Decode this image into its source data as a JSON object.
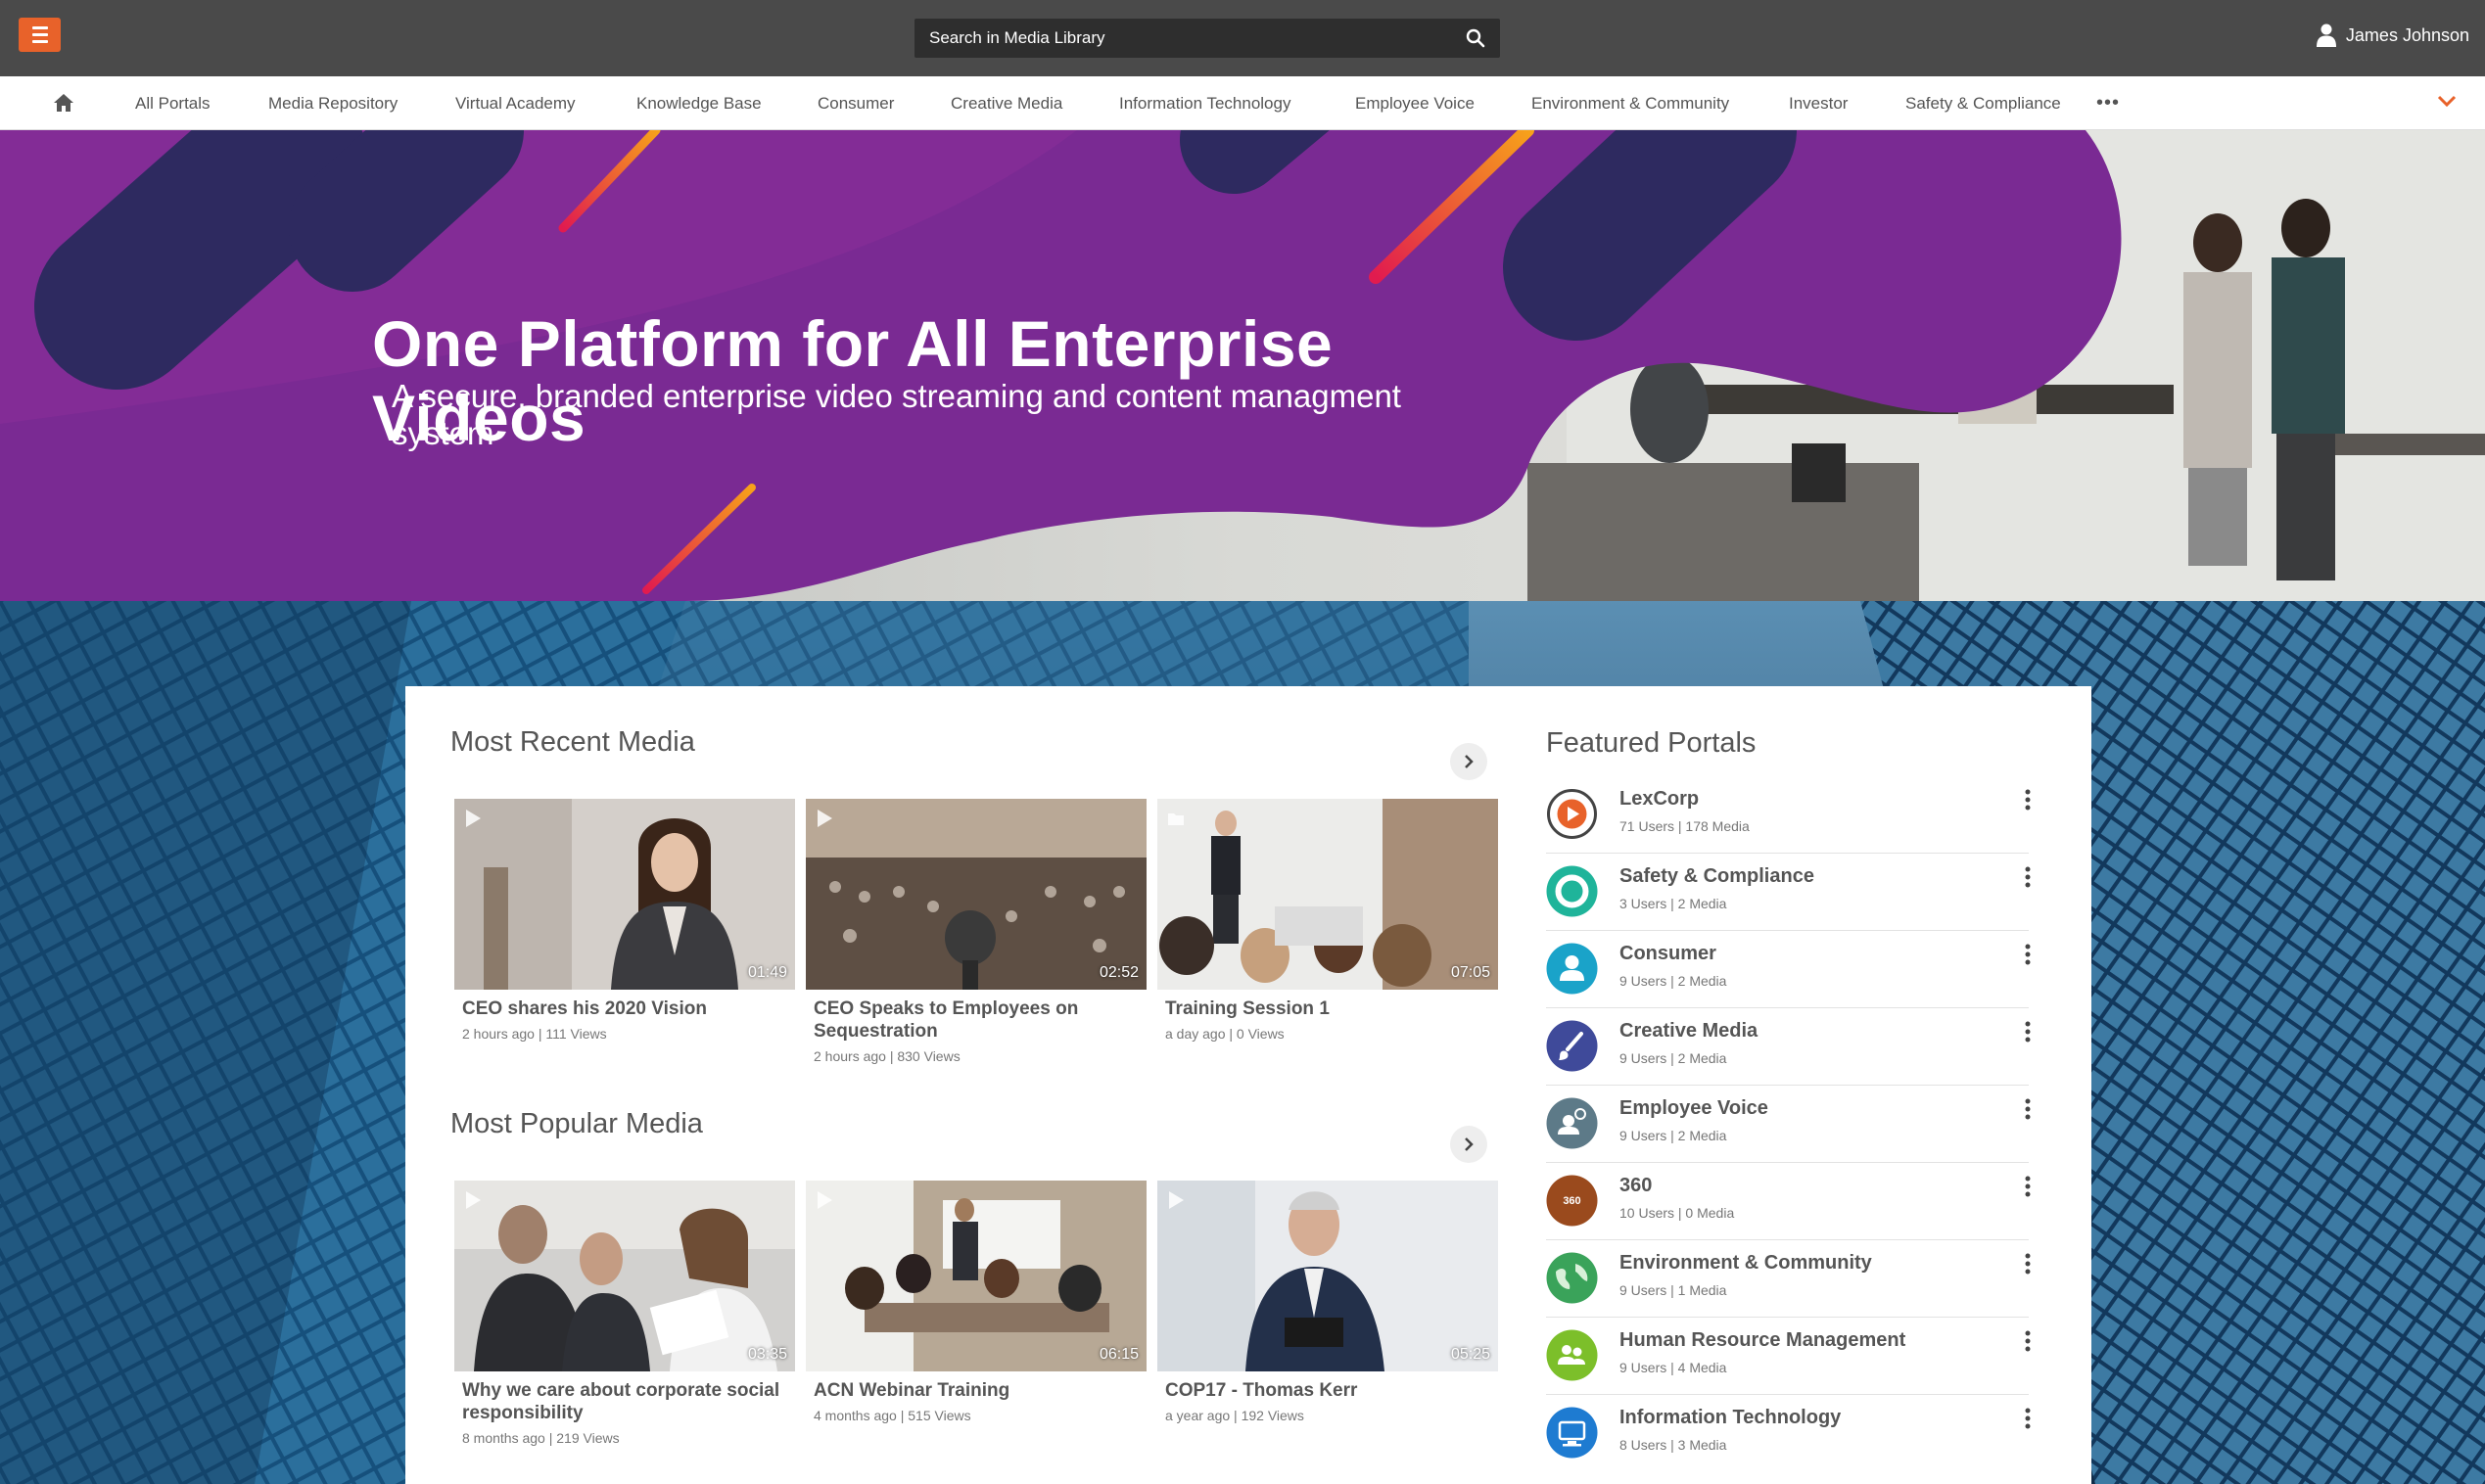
{
  "topbar": {
    "search_placeholder": "Search in Media Library",
    "user_name": "James Johnson",
    "accent": "#e8622a"
  },
  "nav": {
    "items": [
      "All Portals",
      "Media Repository",
      "Virtual Academy",
      "Knowledge Base",
      "Consumer",
      "Creative Media",
      "Information Technology",
      "Employee Voice",
      "Environment & Community",
      "Investor",
      "Safety & Compliance"
    ],
    "more": "•••"
  },
  "hero": {
    "title": "One Platform for All Enterprise Videos",
    "subtitle": "A secure, branded enterprise video streaming and content managment system"
  },
  "recent": {
    "title": "Most Recent Media",
    "cards": [
      {
        "title": "CEO shares his 2020 Vision",
        "meta": "2 hours ago | 111 Views",
        "duration": "01:49",
        "icon": "play-icon"
      },
      {
        "title": "CEO Speaks to Employees on Sequestration",
        "meta": "2 hours ago | 830 Views",
        "duration": "02:52",
        "icon": "play-icon"
      },
      {
        "title": "Training Session 1",
        "meta": "a day ago | 0 Views",
        "duration": "07:05",
        "icon": "folder-icon"
      }
    ]
  },
  "popular": {
    "title": "Most Popular Media",
    "cards": [
      {
        "title": "Why we care about corporate social responsibility",
        "meta": "8 months ago | 219 Views",
        "duration": "03:35",
        "icon": "play-icon"
      },
      {
        "title": "ACN Webinar Training",
        "meta": "4 months ago | 515 Views",
        "duration": "06:15",
        "icon": "play-icon"
      },
      {
        "title": "COP17 - Thomas Kerr",
        "meta": "a year ago | 192 Views",
        "duration": "05:25",
        "icon": "play-icon"
      }
    ]
  },
  "portals": {
    "title": "Featured Portals",
    "items": [
      {
        "name": "LexCorp",
        "meta": "71 Users | 178 Media",
        "color": "#e8622a",
        "icon": "lexcorp-logo-icon"
      },
      {
        "name": "Safety & Compliance",
        "meta": "3 Users | 2 Media",
        "color": "#1fb49a",
        "icon": "lifebuoy-icon"
      },
      {
        "name": "Consumer",
        "meta": "9 Users | 2 Media",
        "color": "#1aa3c9",
        "icon": "person-icon"
      },
      {
        "name": "Creative Media",
        "meta": "9 Users | 2 Media",
        "color": "#3f4a9a",
        "icon": "brush-icon"
      },
      {
        "name": "Employee Voice",
        "meta": "9 Users | 2 Media",
        "color": "#5d7a88",
        "icon": "employee-voice-icon"
      },
      {
        "name": "360",
        "meta": "10 Users | 0 Media",
        "color": "#9a4a1d",
        "icon": "360-icon",
        "label": "360"
      },
      {
        "name": "Environment & Community",
        "meta": "9 Users | 1 Media",
        "color": "#3aa35a",
        "icon": "globe-icon"
      },
      {
        "name": "Human Resource Management",
        "meta": "9 Users | 4 Media",
        "color": "#7cbf2a",
        "icon": "people-icon"
      },
      {
        "name": "Information Technology",
        "meta": "8 Users | 3 Media",
        "color": "#1e7bd1",
        "icon": "computer-icon"
      }
    ]
  }
}
